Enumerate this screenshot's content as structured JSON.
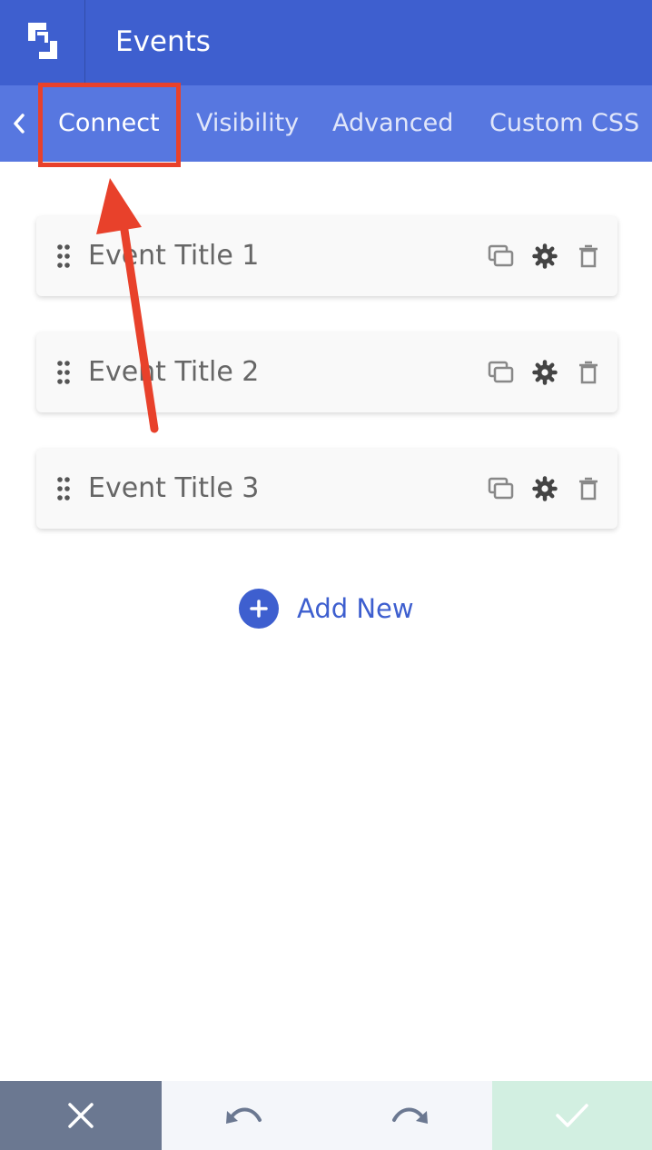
{
  "header": {
    "title": "Events",
    "logo_icon": "brand-logo-icon"
  },
  "tabs": {
    "back_icon": "chevron-left-icon",
    "items": [
      {
        "label": "Connect",
        "active": true
      },
      {
        "label": "Visibility",
        "active": false
      },
      {
        "label": "Advanced",
        "active": false
      },
      {
        "label": "Custom CSS",
        "active": false
      }
    ]
  },
  "items": [
    {
      "title": "Event Title 1"
    },
    {
      "title": "Event Title 2"
    },
    {
      "title": "Event Title 3"
    }
  ],
  "item_icons": [
    "drag-handle-icon",
    "duplicate-icon",
    "gear-icon",
    "trash-icon"
  ],
  "add_new": {
    "label": "Add New",
    "icon": "plus-circle-icon"
  },
  "footer": {
    "buttons": [
      "close-icon",
      "undo-icon",
      "redo-icon",
      "check-icon"
    ]
  },
  "annotation": {
    "highlight": "Connect",
    "color": "#e8412b"
  },
  "colors": {
    "header": "#3e5fcf",
    "tabbar": "#5777e0",
    "accent": "#3e5fcf",
    "cancel": "#6b7891",
    "confirm": "#d2efe1"
  }
}
